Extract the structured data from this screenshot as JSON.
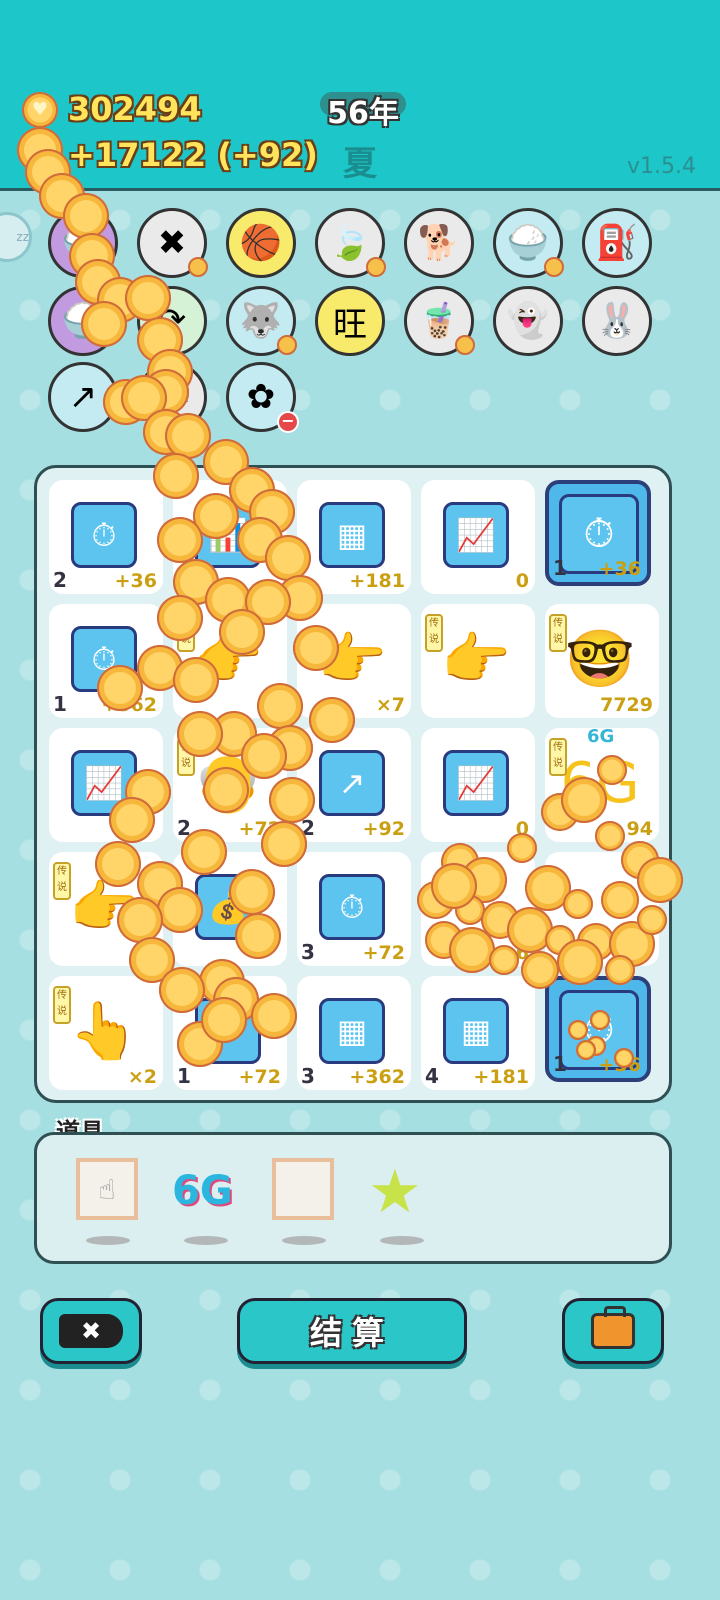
{
  "header": {
    "coins": "302494",
    "income": "+17122 (+92)",
    "year": "56年",
    "season": "夏",
    "version": "v1.5.4"
  },
  "icons": [
    {
      "name": "rice-bowl-icon",
      "glyph": "🍚",
      "color": "purple"
    },
    {
      "name": "delete-tag-icon",
      "glyph": "✖",
      "color": ""
    },
    {
      "name": "basketballs-icon",
      "glyph": "🏀",
      "color": "yellow"
    },
    {
      "name": "leaf-icon",
      "glyph": "🍃",
      "color": ""
    },
    {
      "name": "dog-sunglasses-icon",
      "glyph": "🐕",
      "color": ""
    },
    {
      "name": "rice-bowl-2-icon",
      "glyph": "🍚",
      "color": "blue"
    },
    {
      "name": "pump-icon",
      "glyph": "⛽",
      "color": "blue"
    },
    {
      "name": "rice-bowl-3-icon",
      "glyph": "🍚",
      "color": "purple"
    },
    {
      "name": "refresh-icon",
      "glyph": "⟳",
      "color": "green"
    },
    {
      "name": "husky-icon",
      "glyph": "🐺",
      "color": "blue"
    },
    {
      "name": "wang-tiles-icon",
      "glyph": "旺",
      "color": "yellow"
    },
    {
      "name": "milk-tea-icon",
      "glyph": "🧋",
      "color": ""
    },
    {
      "name": "ghost-icon",
      "glyph": "👻",
      "color": ""
    },
    {
      "name": "rabbit-icon",
      "glyph": "🐰",
      "color": ""
    },
    {
      "name": "growth-arrow-icon",
      "glyph": "↗",
      "color": "blue"
    },
    {
      "name": "cat-icon",
      "glyph": "🐱",
      "color": ""
    },
    {
      "name": "flower-pot-icon",
      "glyph": "✿",
      "color": "blue"
    }
  ],
  "board": [
    {
      "glyph": "⏱",
      "level": "2",
      "bonus": "+36"
    },
    {
      "glyph": "📊",
      "level": "",
      "bonus": ""
    },
    {
      "glyph": "▦",
      "level": "",
      "bonus": "+181"
    },
    {
      "glyph": "📈",
      "level": "",
      "bonus": "0"
    },
    {
      "glyph": "⏱",
      "level": "1",
      "bonus": "+36",
      "selected": true
    },
    {
      "glyph": "⏱",
      "level": "1",
      "bonus": "+362"
    },
    {
      "glyph": "👉",
      "level": "",
      "bonus": "",
      "tag": "传说",
      "plain": true
    },
    {
      "glyph": "👉",
      "level": "",
      "bonus": "×7",
      "plain": true
    },
    {
      "glyph": "👉",
      "level": "",
      "bonus": "",
      "tag": "传说",
      "plain": true
    },
    {
      "glyph": "🤓",
      "level": "",
      "bonus": "7729",
      "tag": "传说",
      "plain": true
    },
    {
      "glyph": "📈",
      "level": "",
      "bonus": ""
    },
    {
      "glyph": "👴",
      "level": "2",
      "bonus": "+72",
      "tag": "传说",
      "plain": true
    },
    {
      "glyph": "↗",
      "level": "2",
      "bonus": "+92"
    },
    {
      "glyph": "📈",
      "level": "",
      "bonus": "0"
    },
    {
      "glyph": "6G",
      "level": "",
      "bonus": "94",
      "tag": "传说",
      "plain": true,
      "sixg": "6G"
    },
    {
      "glyph": "👉",
      "level": "",
      "bonus": "",
      "tag": "传说",
      "plain": true
    },
    {
      "glyph": "💰",
      "level": "",
      "bonus": ""
    },
    {
      "glyph": "⏱",
      "level": "3",
      "bonus": "+72"
    },
    {
      "glyph": "",
      "level": "",
      "bonus": "6"
    },
    {
      "glyph": "",
      "level": "",
      "bonus": ""
    },
    {
      "glyph": "👆",
      "level": "",
      "bonus": "×2",
      "tag": "传说",
      "plain": true
    },
    {
      "glyph": "⏱",
      "level": "1",
      "bonus": "+72"
    },
    {
      "glyph": "▦",
      "level": "3",
      "bonus": "+362"
    },
    {
      "glyph": "▦",
      "level": "4",
      "bonus": "+181"
    },
    {
      "glyph": "⏱",
      "level": "1",
      "bonus": "+36",
      "selected": true
    }
  ],
  "items": {
    "label": "道具",
    "sixg": "6G"
  },
  "buttons": {
    "discard": "✖",
    "settle": "结算"
  }
}
